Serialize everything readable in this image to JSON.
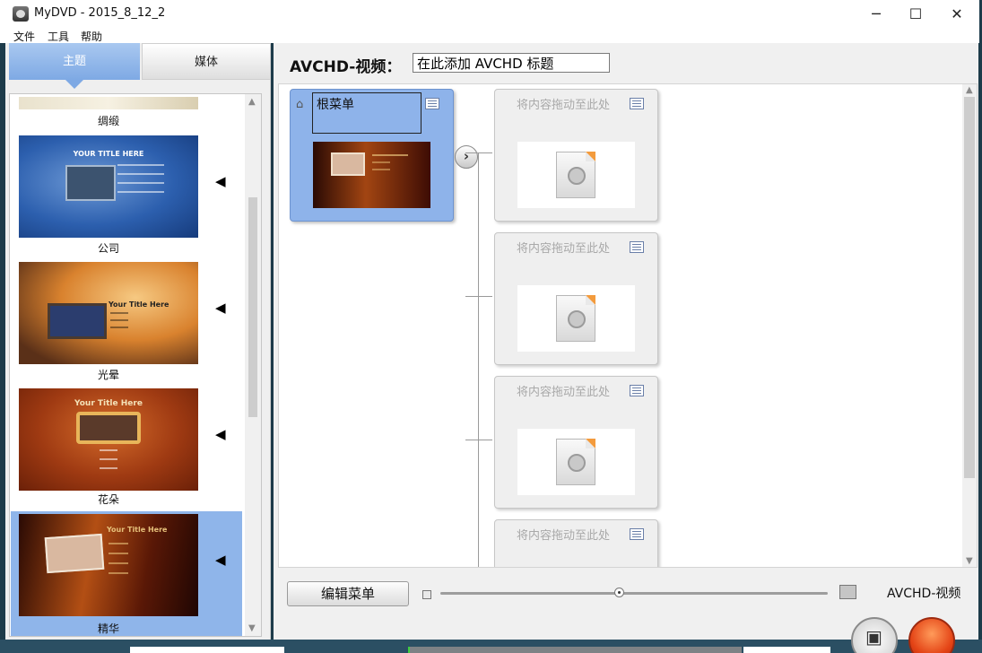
{
  "window": {
    "title": "MyDVD - 2015_8_12_2",
    "minimize": "─",
    "maximize": "☐",
    "close": "✕"
  },
  "menu": {
    "file": "文件",
    "tools": "工具",
    "help": "帮助"
  },
  "tabs": {
    "themes": "主题",
    "media": "媒体"
  },
  "themes": [
    {
      "name": "绸缎",
      "caption": "",
      "selected": false
    },
    {
      "name": "公司",
      "caption": "YOUR TITLE HERE",
      "selected": false
    },
    {
      "name": "光晕",
      "caption": "Your Title Here",
      "selected": false
    },
    {
      "name": "花朵",
      "caption": "Your Title Here",
      "selected": false
    },
    {
      "name": "精华",
      "caption": "Your Title Here",
      "selected": true
    }
  ],
  "theme_apply_icon": "◀",
  "header": {
    "label": "AVCHD-视频：",
    "title_value": "在此添加 AVCHD 标题"
  },
  "root_menu": {
    "name": "根菜单",
    "next_icon": "chevron-right-icon"
  },
  "drop_hint": "将内容拖动至此处",
  "slot_count": 4,
  "footer_controls": {
    "edit_menu": "编辑菜单",
    "mode_label": "AVCHD-视频"
  },
  "icons": {
    "home": "home-icon",
    "menu_options": "list-icon",
    "video_placeholder": "video-file-icon",
    "save": "save-icon",
    "burn": "burn-icon"
  },
  "colors": {
    "tab_active": "#8fb5ea",
    "selected": "#8fb5ea",
    "root_node": "#8eb3ea"
  }
}
